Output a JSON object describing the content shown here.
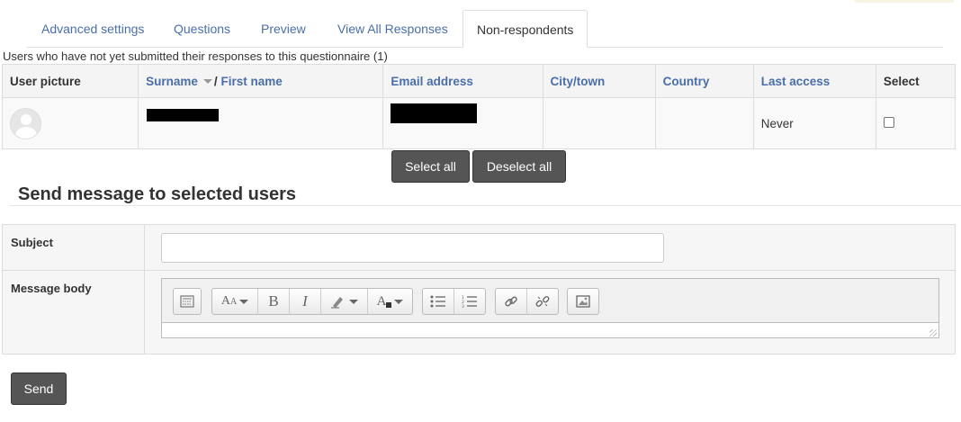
{
  "tabs": [
    {
      "label": "Advanced settings",
      "active": false
    },
    {
      "label": "Questions",
      "active": false
    },
    {
      "label": "Preview",
      "active": false
    },
    {
      "label": "View All Responses",
      "active": false
    },
    {
      "label": "Non-respondents",
      "active": true
    }
  ],
  "caption": "Users who have not yet submitted their responses to this questionnaire (1)",
  "table": {
    "headers": {
      "user_picture": "User picture",
      "surname": "Surname",
      "name_sep": "/",
      "first_name": "First name",
      "email": "Email address",
      "city": "City/town",
      "country": "Country",
      "last_access": "Last access",
      "select": "Select"
    },
    "rows": [
      {
        "name": "[redacted]",
        "email": "[redacted]",
        "city": "",
        "country": "",
        "last_access": "Never",
        "selected": false
      }
    ]
  },
  "buttons": {
    "select_all": "Select all",
    "deselect_all": "Deselect all",
    "send": "Send"
  },
  "message_section": {
    "title": "Send message to selected users",
    "subject_label": "Subject",
    "subject_value": "",
    "body_label": "Message body"
  },
  "editor_toolbar": {
    "groups": [
      [
        "toolbar-toggle-icon"
      ],
      [
        "font-size-icon",
        "bold-icon",
        "italic-icon",
        "highlight-icon",
        "font-color-icon"
      ],
      [
        "unordered-list-icon",
        "ordered-list-icon"
      ],
      [
        "link-icon",
        "unlink-icon"
      ],
      [
        "image-icon"
      ]
    ]
  },
  "colors": {
    "link": "#4a6ea9",
    "button_bg": "#555555",
    "border": "#dddddd"
  }
}
